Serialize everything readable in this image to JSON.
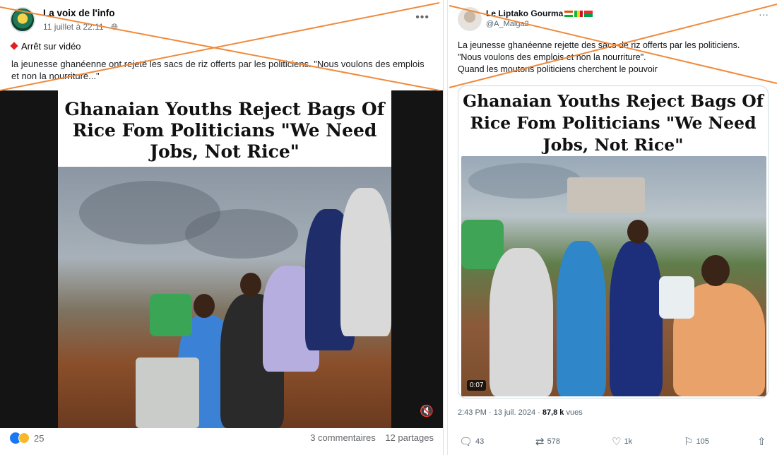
{
  "facebook_post": {
    "author": "La voix de l'info",
    "date": "11 juillet à 22:11 ·",
    "more": "•••",
    "label": "Arrêt sur vidéo",
    "caption": "la jeunesse ghanéenne ont rejeté les sacs de riz offerts par les politiciens. \"Nous voulons des emplois et non la nourriture...\"",
    "video_title": "Ghanaian Youths Reject Bags Of Rice Fom Politicians \"We Need Jobs, Not Rice\"",
    "mute_icon": "🔇",
    "reactions_count": "25",
    "comments": "3 commentaires",
    "shares": "12 partages"
  },
  "twitter_post": {
    "author": "Le Liptako Gourma",
    "handle": "@A_Maiga2",
    "more": "···",
    "text_line1": "La jeunesse ghanéenne rejette des sacs de riz offerts par les politiciens.",
    "text_line2": "\"Nous voulons des emplois et non la nourriture\".",
    "text_line3": "Quand les moutons politiciens cherchent le pouvoir",
    "video_title": "Ghanaian Youths Reject Bags Of Rice Fom Politicians \"We Need Jobs, Not Rice\"",
    "duration": "0:07",
    "time_date": "2:43 PM · 13 juil. 2024 · ",
    "views_count": "87,8 k",
    "views_label": " vues",
    "replies": "43",
    "reposts": "578",
    "likes": "1k",
    "bookmarks": "105"
  },
  "colors": {
    "overlay_cross": "#f08a3c",
    "facebook_blue": "#1877f2",
    "stop_red": "#e02020"
  }
}
